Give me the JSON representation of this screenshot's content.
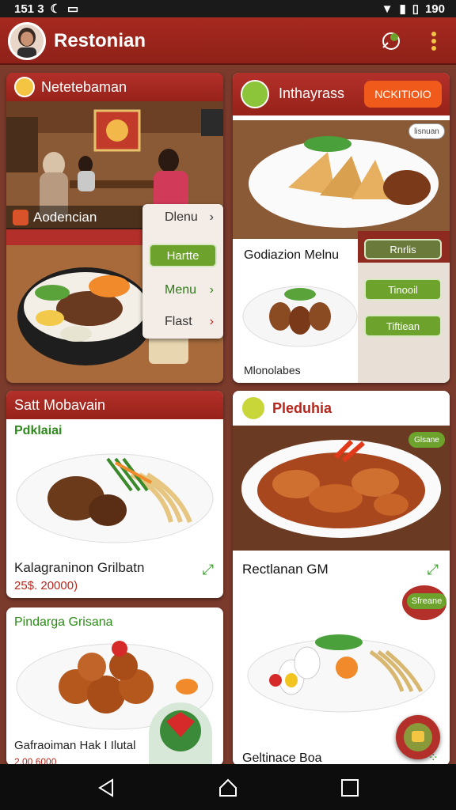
{
  "status": {
    "time": "151 3",
    "battery_text": "190"
  },
  "appbar": {
    "title": "Restonian"
  },
  "card1": {
    "header": "Netetebaman",
    "subtitle": "Aodencian"
  },
  "popup_menu": {
    "item1": "Dlenu",
    "button": "Hartte",
    "item2": "Menu",
    "item3": "Flast"
  },
  "card2": {
    "header": "Inthayrass",
    "action": "NCKITIOIO",
    "tag": "lisnuan",
    "section": "Godiazion Melnu",
    "caption": "Mlonolabes",
    "side_buttons": [
      "Rnrlis",
      "Tinooil",
      "Tiftiean"
    ]
  },
  "card3": {
    "header": "Satt Mobavain",
    "subheader": "Pdklaiai",
    "dish_name": "Kalagraninon Grilbatn",
    "price": "25$. 20000)"
  },
  "card4": {
    "header": "Pleduhia",
    "tag": "Glsane",
    "dish_name": "Rectlanan GM",
    "tag2": "Sfreane",
    "dish_name2": "Geltinace Boa"
  },
  "card5": {
    "header": "Pindarga Grisana",
    "dish_name": "Gafraoiman Hak I Ilutal",
    "price": "2.00 6000"
  },
  "colors": {
    "brand": "#a6291f",
    "accent": "#f05a1a",
    "green": "#6da32d"
  }
}
